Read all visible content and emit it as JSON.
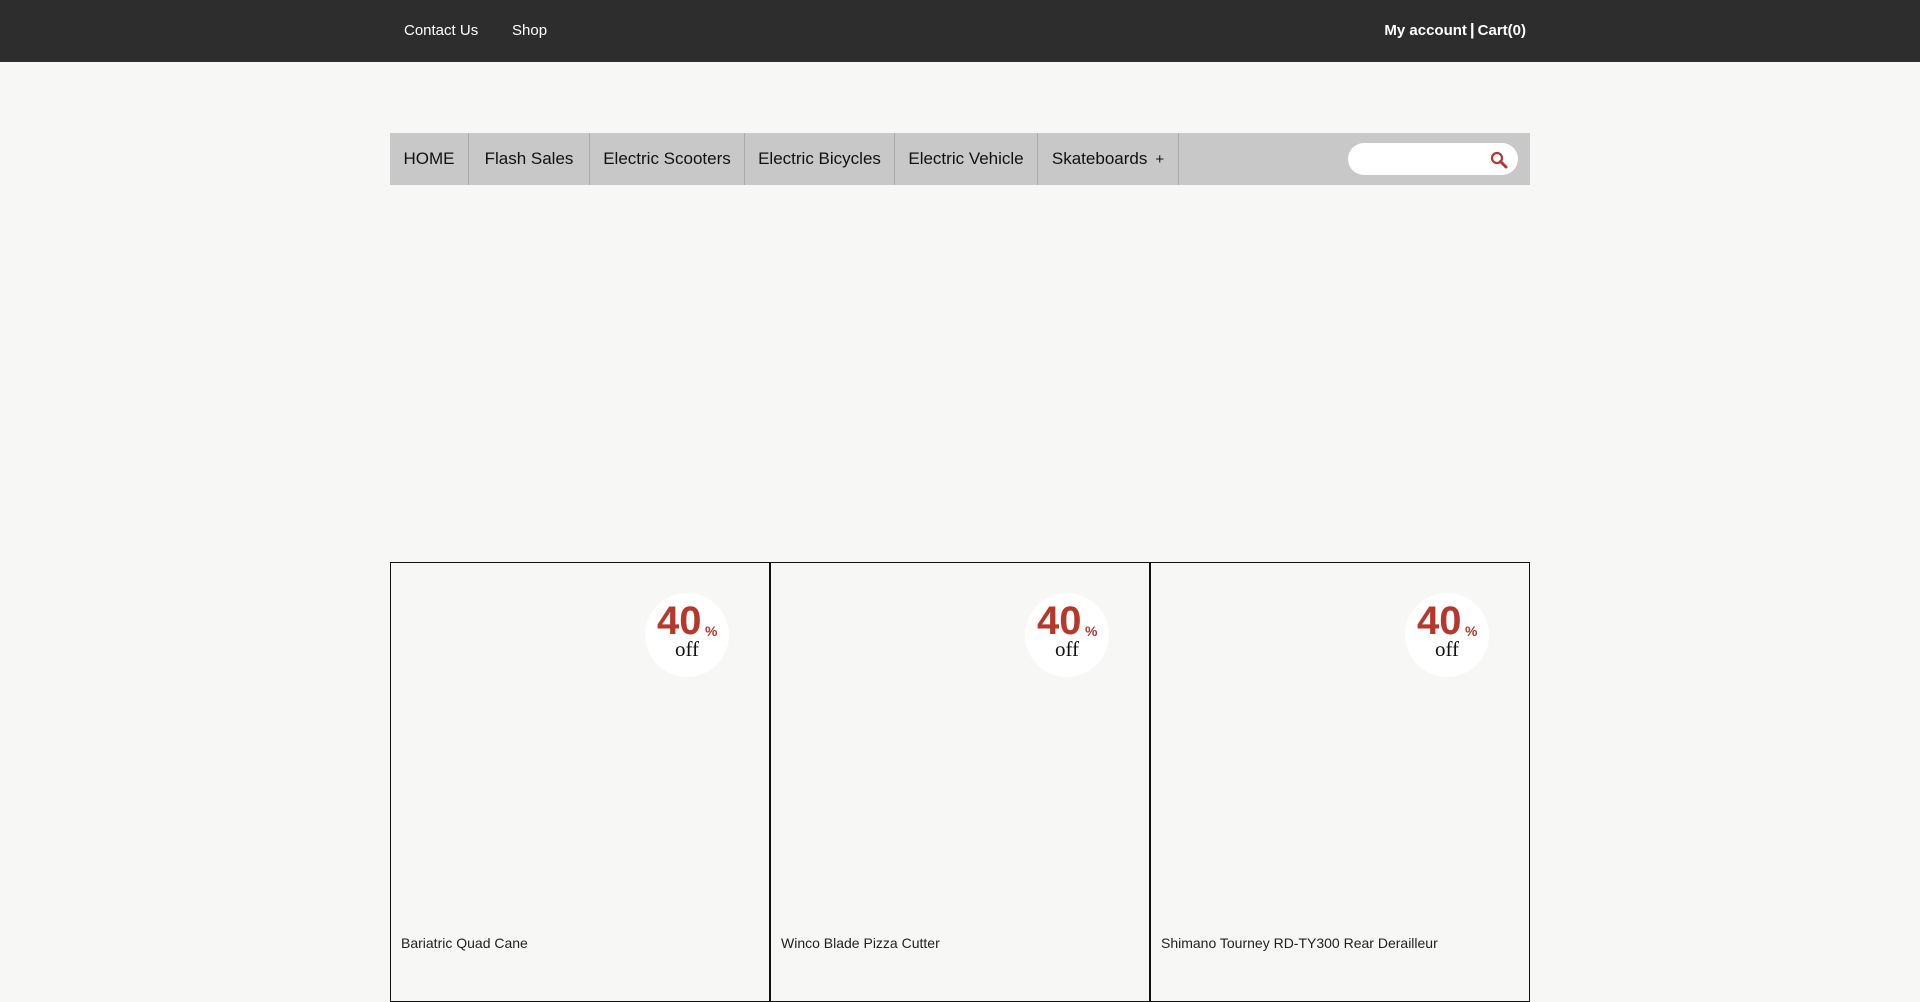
{
  "topbar": {
    "links": [
      "Contact Us",
      "Shop"
    ],
    "account_label": "My account",
    "separator": "|",
    "cart_label": "Cart(0)",
    "background": "#2d2d2d"
  },
  "nav": {
    "items": [
      "HOME",
      "Flash Sales",
      "Electric Scooters",
      "Electric Bicycles",
      "Electric Vehicle",
      "Skateboards"
    ],
    "expand_symbol": "+",
    "search_placeholder": "",
    "background": "#c8c8c8"
  },
  "products": [
    {
      "name": "Bariatric Quad Cane",
      "discount": "40",
      "percent_sign": "%",
      "off_label": "off"
    },
    {
      "name": "Winco Blade Pizza Cutter",
      "discount": "40",
      "percent_sign": "%",
      "off_label": "off"
    },
    {
      "name": "Shimano Tourney RD-TY300 Rear Derailleur",
      "discount": "40",
      "percent_sign": "%",
      "off_label": "off"
    }
  ],
  "colors": {
    "accent": "#b5382d",
    "page_background": "#f7f7f5"
  },
  "icons": {
    "search": "search-icon"
  }
}
